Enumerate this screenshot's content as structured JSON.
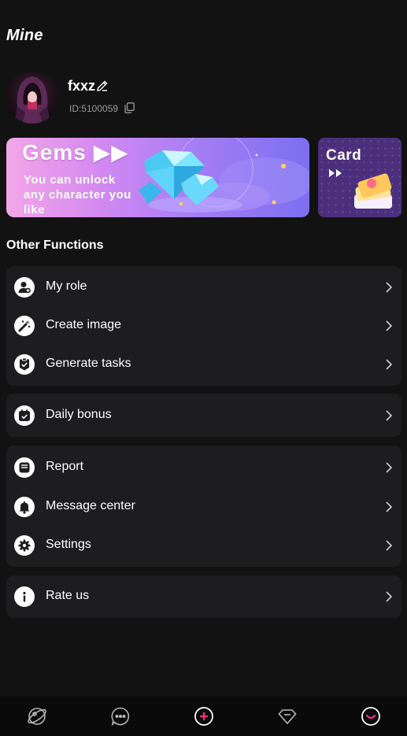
{
  "header": {
    "title": "Mine"
  },
  "profile": {
    "username": "fxxz",
    "id_text": "ID:5100059"
  },
  "banners": {
    "gems": {
      "title": "Gems ▶▶",
      "subtitle": "You can unlock any character you like"
    },
    "card": {
      "title": "Card"
    }
  },
  "section": {
    "title": "Other Functions"
  },
  "groups": [
    {
      "items": [
        {
          "label": "My role",
          "icon": "user-add-icon"
        },
        {
          "label": "Create image",
          "icon": "magic-wand-icon"
        },
        {
          "label": "Generate tasks",
          "icon": "task-check-icon"
        }
      ]
    },
    {
      "items": [
        {
          "label": "Daily bonus",
          "icon": "calendar-check-icon"
        }
      ]
    },
    {
      "items": [
        {
          "label": "Report",
          "icon": "inbox-icon"
        },
        {
          "label": "Message center",
          "icon": "bell-icon"
        },
        {
          "label": "Settings",
          "icon": "gear-icon"
        }
      ]
    },
    {
      "items": [
        {
          "label": "Rate us",
          "icon": "info-icon"
        }
      ]
    }
  ],
  "bottom_nav": [
    "explore-icon",
    "chat-icon",
    "create-plus-icon",
    "gem-icon",
    "profile-icon"
  ],
  "colors": {
    "background": "#121212",
    "card_bg": "#1d1d1f",
    "accent": "#ff2d8a"
  }
}
